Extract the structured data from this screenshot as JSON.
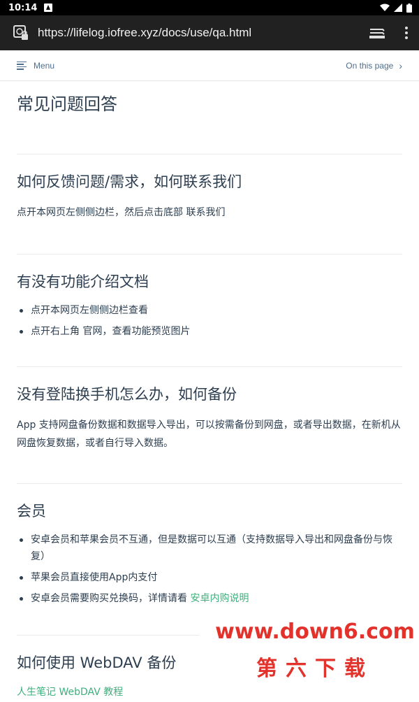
{
  "status_bar": {
    "time": "10:14"
  },
  "browser": {
    "url": "https://lifelog.iofree.xyz/docs/use/qa.html"
  },
  "doc_nav": {
    "menu_label": "Menu",
    "on_this_page_label": "On this page"
  },
  "page": {
    "title": "常见问题回答",
    "sections": [
      {
        "heading": "如何反馈问题/需求，如何联系我们",
        "text": "点开本网页左侧侧边栏，然后点击底部 联系我们"
      },
      {
        "heading": "有没有功能介绍文档",
        "items": [
          "点开本网页左侧侧边栏查看",
          "点开右上角 官网，查看功能预览图片"
        ]
      },
      {
        "heading": "没有登陆换手机怎么办，如何备份",
        "text": "App 支持网盘备份数据和数据导入导出，可以按需备份到网盘，或者导出数据，在新机从网盘恢复数据，或者自行导入数据。"
      },
      {
        "heading": "会员",
        "items": [
          "安卓会员和苹果会员不互通，但是数据可以互通（支持数据导入导出和网盘备份与恢复）",
          "苹果会员直接使用App内支付",
          "安卓会员需要购买兑换码，详情请看 "
        ],
        "link_text": "安卓内购说明"
      },
      {
        "heading": "如何使用 WebDAV 备份",
        "link_text": "人生笔记 WebDAV 教程"
      }
    ]
  },
  "watermark": {
    "url": "www.down6.com",
    "text": "第六下载"
  },
  "colors": {
    "accent": "#3eaf7c",
    "text": "#2c3e50",
    "watermark": "#e3322b",
    "toolbar": "#212121"
  }
}
